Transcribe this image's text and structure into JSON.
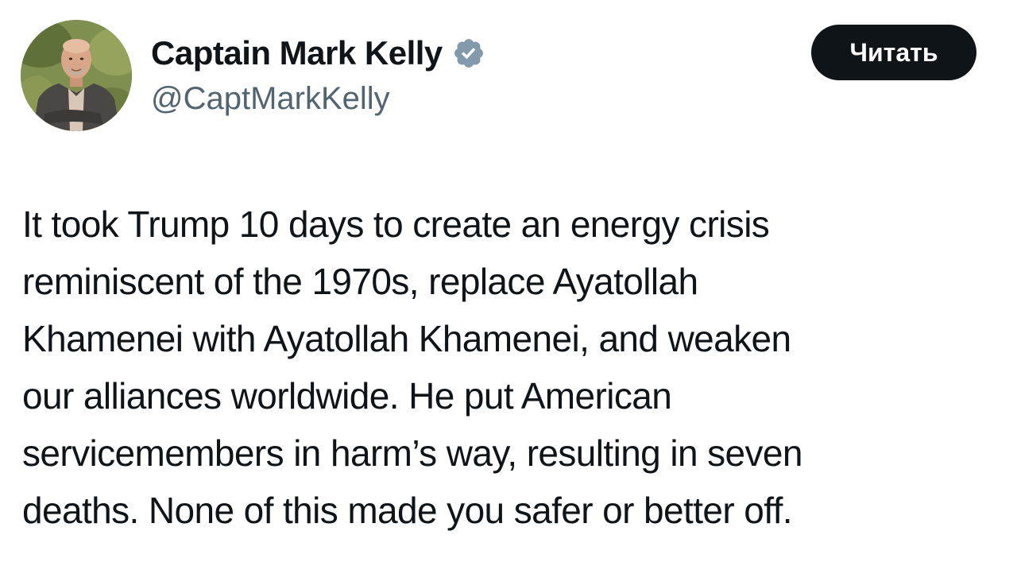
{
  "author": {
    "display_name": "Captain Mark Kelly",
    "handle": "@CaptMarkKelly",
    "verified": true,
    "avatar_icon": "profile-photo"
  },
  "follow_button": {
    "label": "Читать"
  },
  "tweet": {
    "lines": [
      "It took Trump 10 days to create an energy crisis",
      "reminiscent of the 1970s, replace Ayatollah",
      "Khamenei with Ayatollah Khamenei, and weaken",
      "our alliances worldwide. He put American",
      "servicemembers in harm’s way, resulting in seven",
      "deaths. None of this made you safer or better off."
    ]
  },
  "colors": {
    "text": "#0f1419",
    "secondary_text": "#536471",
    "verified_badge": "#829aab",
    "button_bg": "#0f1419",
    "button_text": "#ffffff"
  }
}
